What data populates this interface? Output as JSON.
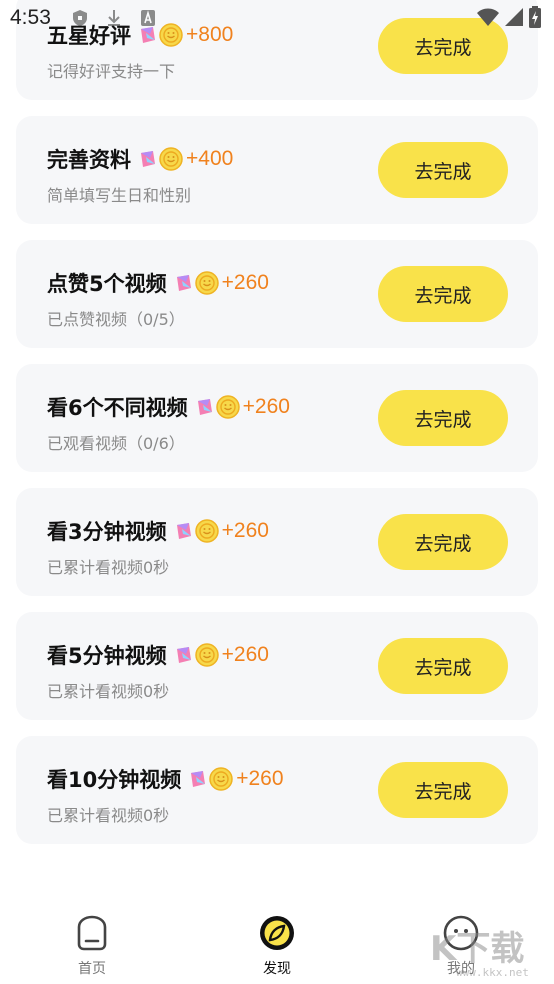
{
  "status_bar": {
    "time": "4:53",
    "notification_icons": [
      "shield-icon",
      "download-icon",
      "font-icon"
    ],
    "right_icons": [
      "wifi-icon",
      "signal-icon",
      "battery-charging-icon"
    ]
  },
  "tasks": [
    {
      "title": "五星好评",
      "reward": "+800",
      "desc": "记得好评支持一下",
      "button": "去完成"
    },
    {
      "title": "完善资料",
      "reward": "+400",
      "desc": "简单填写生日和性别",
      "button": "去完成"
    },
    {
      "title": "点赞5个视频",
      "reward": "+260",
      "desc": "已点赞视频（0/5）",
      "button": "去完成"
    },
    {
      "title": "看6个不同视频",
      "reward": "+260",
      "desc": "已观看视频（0/6）",
      "button": "去完成"
    },
    {
      "title": "看3分钟视频",
      "reward": "+260",
      "desc": "已累计看视频0秒",
      "button": "去完成"
    },
    {
      "title": "看5分钟视频",
      "reward": "+260",
      "desc": "已累计看视频0秒",
      "button": "去完成"
    },
    {
      "title": "看10分钟视频",
      "reward": "+260",
      "desc": "已累计看视频0秒",
      "button": "去完成"
    }
  ],
  "bottom_nav": [
    {
      "label": "首页",
      "icon": "home-icon",
      "active": false
    },
    {
      "label": "发现",
      "icon": "compass-icon",
      "active": true
    },
    {
      "label": "我的",
      "icon": "profile-icon",
      "active": false
    }
  ],
  "watermark": {
    "text": "K下载",
    "sub": "www.kkx.net"
  },
  "colors": {
    "accent_yellow": "#f9e24a",
    "reward_orange": "#f0821e",
    "card_bg": "#f6f7f9",
    "desc_gray": "#8a8a8a"
  }
}
